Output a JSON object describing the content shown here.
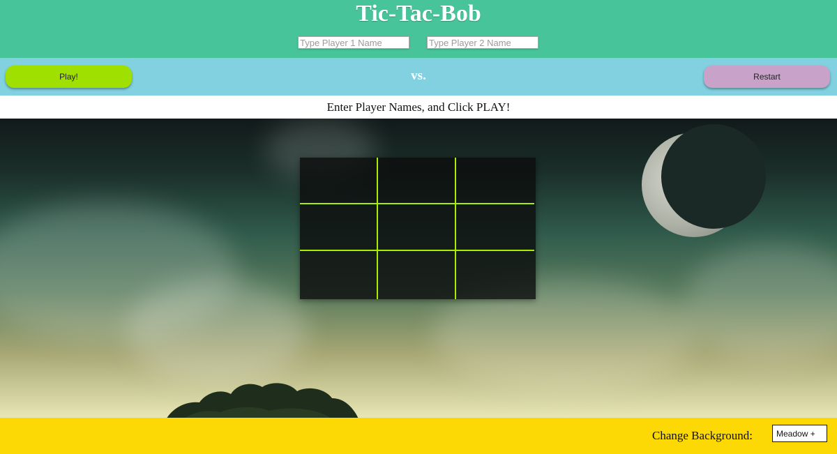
{
  "header": {
    "title": "Tic-Tac-Bob",
    "player1_placeholder": "Type Player 1 Name",
    "player2_placeholder": "Type Player 2 Name",
    "background_color": "#48c49a"
  },
  "controls": {
    "play_label": "Play!",
    "vs_label": "vs.",
    "restart_label": "Restart",
    "play_color": "#a0e000",
    "restart_color": "#c8a2c8",
    "bar_color": "#81d1e0"
  },
  "status": {
    "message": "Enter Player Names, and Click PLAY!"
  },
  "board": {
    "cells": [
      "",
      "",
      "",
      "",
      "",
      "",
      "",
      "",
      ""
    ],
    "grid_line_color": "#a8ee00"
  },
  "footer": {
    "change_background_label": "Change Background:",
    "background_select_value": "Meadow +",
    "background_color": "#fcd804"
  }
}
